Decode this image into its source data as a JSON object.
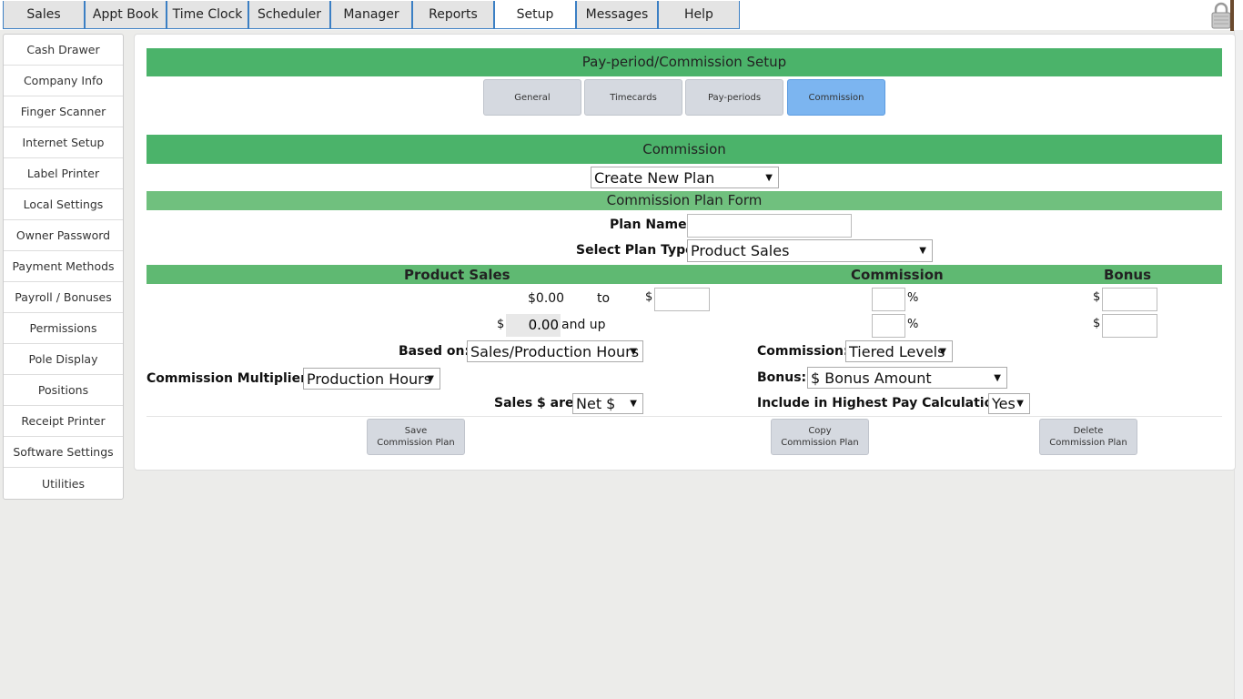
{
  "nav": {
    "tabs": [
      {
        "label": "Sales"
      },
      {
        "label": "Appt Book"
      },
      {
        "label": "Time Clock"
      },
      {
        "label": "Scheduler"
      },
      {
        "label": "Manager"
      },
      {
        "label": "Reports"
      },
      {
        "label": "Setup"
      },
      {
        "label": "Messages"
      },
      {
        "label": "Help"
      }
    ],
    "active": "Setup"
  },
  "sidebar": {
    "items": [
      {
        "label": "Cash Drawer"
      },
      {
        "label": "Company Info"
      },
      {
        "label": "Finger Scanner"
      },
      {
        "label": "Internet Setup"
      },
      {
        "label": "Label Printer"
      },
      {
        "label": "Local Settings"
      },
      {
        "label": "Owner Password"
      },
      {
        "label": "Payment Methods"
      },
      {
        "label": "Payroll / Bonuses"
      },
      {
        "label": "Permissions"
      },
      {
        "label": "Pole Display"
      },
      {
        "label": "Positions"
      },
      {
        "label": "Receipt Printer"
      },
      {
        "label": "Software Settings"
      },
      {
        "label": "Utilities"
      }
    ]
  },
  "panel": {
    "title": "Pay-period/Commission Setup",
    "subtabs": [
      {
        "label": "General"
      },
      {
        "label": "Timecards"
      },
      {
        "label": "Pay-periods"
      },
      {
        "label": "Commission"
      }
    ],
    "active_subtab": "Commission"
  },
  "commission": {
    "title": "Commission",
    "plan_select": "Create New Plan",
    "form_title": "Commission Plan Form",
    "plan_name_label": "Plan Name:",
    "plan_name_value": "",
    "plan_type_label": "Select Plan Type:",
    "plan_type_value": "Product Sales",
    "columns": {
      "product_sales": "Product Sales",
      "commission": "Commission",
      "bonus": "Bonus"
    },
    "tier1": {
      "from": "$0.00",
      "to_label": "to",
      "dollar": "$",
      "pct": "%",
      "bonus_dollar": "$"
    },
    "tier2": {
      "dollar": "$",
      "from": "0.00",
      "and_up": "and up",
      "pct": "%",
      "bonus_dollar": "$"
    },
    "based_on_label": "Based on:",
    "based_on_value": "Sales/Production Hours",
    "commission_type_label": "Commission:",
    "commission_type_value": "Tiered Levels",
    "multiplier_label": "Commission Multiplier:",
    "multiplier_value": "Production Hours",
    "bonus_label": "Bonus:",
    "bonus_value": "$ Bonus Amount",
    "sales_are_label": "Sales $ are:",
    "sales_are_value": "Net $",
    "highest_pay_label": "Include in Highest Pay Calculation:",
    "highest_pay_value": "Yes",
    "buttons": {
      "save": "Save Commission Plan",
      "copy": "Copy Commission Plan",
      "delete": "Delete Commission Plan"
    }
  }
}
